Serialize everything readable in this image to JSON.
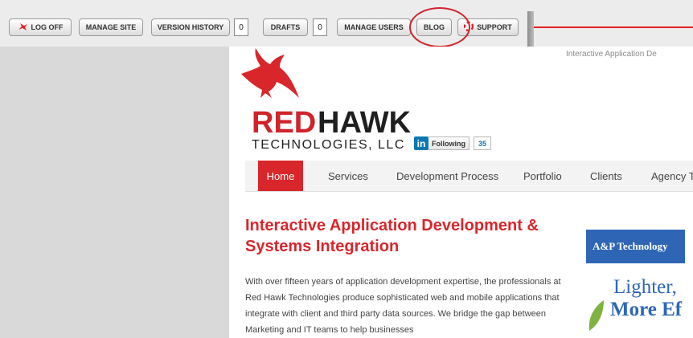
{
  "toolbar": {
    "log_off": "LOG OFF",
    "manage_site": "MANAGE SITE",
    "version_history": "VERSION HISTORY",
    "version_count": "0",
    "drafts": "DRAFTS",
    "drafts_count": "0",
    "manage_users": "MANAGE USERS",
    "blog": "BLOG",
    "support": "SUPPORT"
  },
  "site": {
    "tagline": "Interactive Application De",
    "logo": {
      "red_text": "RED",
      "black_text": "HAWK",
      "subtitle": "TECHNOLOGIES, LLC"
    },
    "linkedin": {
      "logo_text": "in",
      "follow_label": "Following",
      "count": "35"
    },
    "nav": [
      "Home",
      "Services",
      "Development Process",
      "Portfolio",
      "Clients",
      "Agency T"
    ],
    "headline": "Interactive Application Development & Systems Integration",
    "body": "With over fifteen years of application development expertise, the professionals at Red Hawk Technologies produce sophisticated web and mobile applications that integrate with client and third party data sources. We bridge the gap between Marketing and IT teams to help businesses",
    "ad": {
      "brand": "A&P Technology",
      "line1": "Lighter,",
      "line2": "More Ef"
    }
  },
  "colors": {
    "brand_red": "#d9262b",
    "toolbar_bg": "#ececec",
    "ad_blue": "#2e66b5",
    "annotation": "#d0252a"
  }
}
